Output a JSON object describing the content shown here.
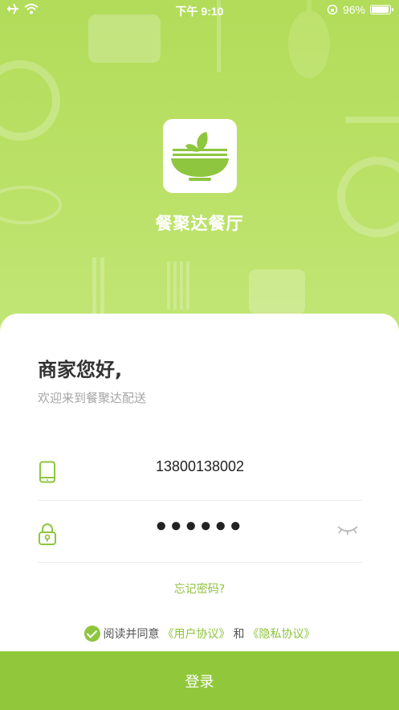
{
  "status_bar": {
    "time": "下午 9:10",
    "battery": "96%",
    "battery_level": 0.96
  },
  "app": {
    "name": "餐聚达餐厅",
    "logo_icon": "noodle-bowl-icon"
  },
  "login": {
    "greeting": "商家您好,",
    "subtitle": "欢迎来到餐聚达配送",
    "phone": {
      "value": "13800138002",
      "icon": "phone-icon"
    },
    "password": {
      "masked": "●●●●●●",
      "icon": "lock-icon",
      "toggle_icon": "eye-closed-icon"
    },
    "forgot_label": "忘记密码?",
    "agreement": {
      "prefix": "阅读并同意",
      "user_agreement": "《用户协议》",
      "and": "和",
      "privacy": "《隐私协议》",
      "checked": true
    },
    "submit_label": "登录"
  },
  "colors": {
    "accent": "#91c83b",
    "link": "#8cc33a",
    "hero": "#b9e064"
  }
}
